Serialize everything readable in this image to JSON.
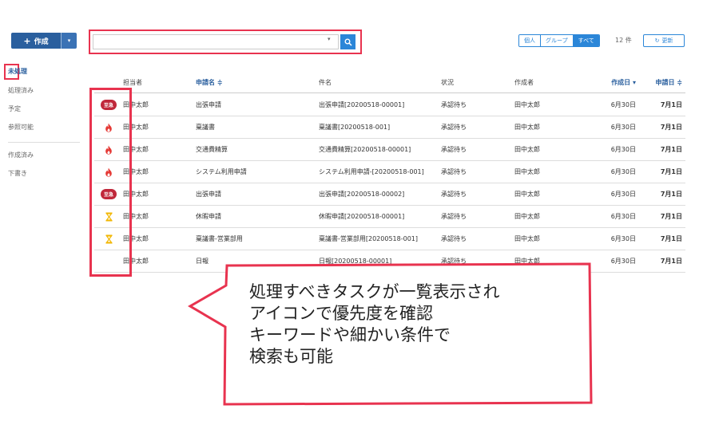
{
  "toolbar": {
    "create_label": "作成",
    "create_plus": "+",
    "create_dropdown": "▾"
  },
  "sidebar": {
    "items": [
      {
        "label": "未処理",
        "active": true
      },
      {
        "label": "処理済み"
      },
      {
        "label": "予定"
      },
      {
        "label": "参照可能"
      },
      {
        "label": "作成済み"
      },
      {
        "label": "下書き"
      }
    ]
  },
  "search": {
    "value": "",
    "placeholder": "",
    "dropdown_caret": "▾",
    "button_icon": "search-icon"
  },
  "filters": {
    "segments": [
      {
        "label": "個人",
        "selected": false
      },
      {
        "label": "グループ",
        "selected": false
      },
      {
        "label": "すべて",
        "selected": true
      }
    ],
    "count_label": "12 件",
    "refresh_label": "更新",
    "refresh_icon": "↻"
  },
  "table": {
    "headers": {
      "assignee": "担当者",
      "type": "申請名 ≑",
      "subject": "件名",
      "status": "状況",
      "creator": "作成者",
      "created": "作成日 ▾",
      "applied": "申請日 ≑"
    },
    "rows": [
      {
        "priority": "urgent",
        "priority_label": "至急",
        "assignee": "田中太郎",
        "type": "出張申請",
        "subject": "出張申請[20200518-00001]",
        "status": "承認待ち",
        "creator": "田中太郎",
        "created": "6月30日",
        "applied": "7月1日"
      },
      {
        "priority": "fire",
        "assignee": "田中太郎",
        "type": "稟議書",
        "subject": "稟議書[20200518-001]",
        "status": "承認待ち",
        "creator": "田中太郎",
        "created": "6月30日",
        "applied": "7月1日"
      },
      {
        "priority": "fire",
        "assignee": "田中太郎",
        "type": "交通費精算",
        "subject": "交通費精算[20200518-00001]",
        "status": "承認待ち",
        "creator": "田中太郎",
        "created": "6月30日",
        "applied": "7月1日"
      },
      {
        "priority": "fire",
        "assignee": "田中太郎",
        "type": "システム利用申請",
        "subject": "システム利用申請-[20200518-001]",
        "status": "承認待ち",
        "creator": "田中太郎",
        "created": "6月30日",
        "applied": "7月1日"
      },
      {
        "priority": "urgent",
        "priority_label": "至急",
        "assignee": "田中太郎",
        "type": "出張申請",
        "subject": "出張申請[20200518-00002]",
        "status": "承認待ち",
        "creator": "田中太郎",
        "created": "6月30日",
        "applied": "7月1日"
      },
      {
        "priority": "hourglass",
        "assignee": "田中太郎",
        "type": "休暇申請",
        "subject": "休暇申請[20200518-00001]",
        "status": "承認待ち",
        "creator": "田中太郎",
        "created": "6月30日",
        "applied": "7月1日"
      },
      {
        "priority": "hourglass",
        "assignee": "田中太郎",
        "type": "稟議書-営業部用",
        "subject": "稟議書-営業部用[20200518-001]",
        "status": "承認待ち",
        "creator": "田中太郎",
        "created": "6月30日",
        "applied": "7月1日"
      },
      {
        "priority": "none",
        "assignee": "田中太郎",
        "type": "日報",
        "subject": "日報[20200518-00001]",
        "status": "承認待ち",
        "creator": "田中太郎",
        "created": "6月30日",
        "applied": "7月1日"
      }
    ]
  },
  "callout": {
    "lines": [
      "処理すべきタスクが一覧表示され",
      "アイコンで優先度を確認",
      "キーワードや細かい条件で",
      "検索も可能"
    ]
  },
  "colors": {
    "accent": "#2b86d8",
    "brand": "#2a5f9e",
    "highlight": "#e8334f",
    "urgent": "#c0283b",
    "fire": "#e53935",
    "hourglass": "#f2b705"
  }
}
